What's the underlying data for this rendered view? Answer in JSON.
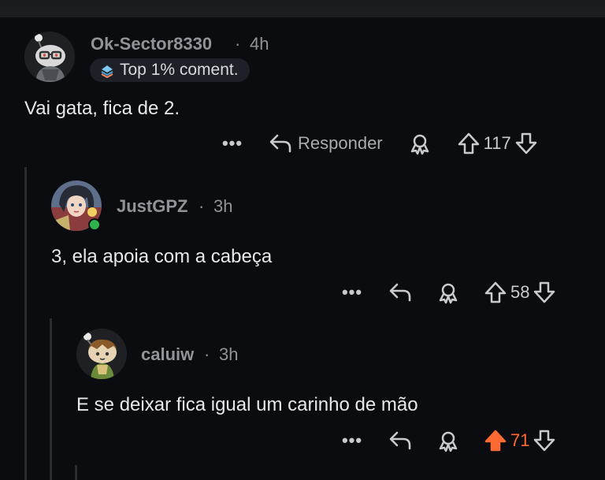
{
  "comments": [
    {
      "username": "Ok-Sector8330",
      "separator": "·",
      "time": "4h",
      "badge": "Top 1% coment.",
      "text": "Vai gata, fica de 2.",
      "more": "•••",
      "reply_label": "Responder",
      "votes": "117"
    },
    {
      "username": "JustGPZ",
      "separator": "·",
      "time": "3h",
      "text": "3, ela apoia com a cabeça",
      "more": "•••",
      "votes": "58"
    },
    {
      "username": "caluiw",
      "separator": "·",
      "time": "3h",
      "text": "E se deixar fica igual um carinho de mão",
      "more": "•••",
      "votes": "71",
      "upvoted": true
    }
  ],
  "colors": {
    "background": "#0b0c10",
    "upvote_active": "#ff6a33",
    "online": "#2fb34f",
    "muted_text": "#8f9499"
  },
  "icons": [
    "snoo-avatar",
    "anime-avatar",
    "snoo-avatar-2",
    "top-commenter-icon",
    "more-icon",
    "reply-icon",
    "award-icon",
    "upvote-icon",
    "downvote-icon"
  ]
}
